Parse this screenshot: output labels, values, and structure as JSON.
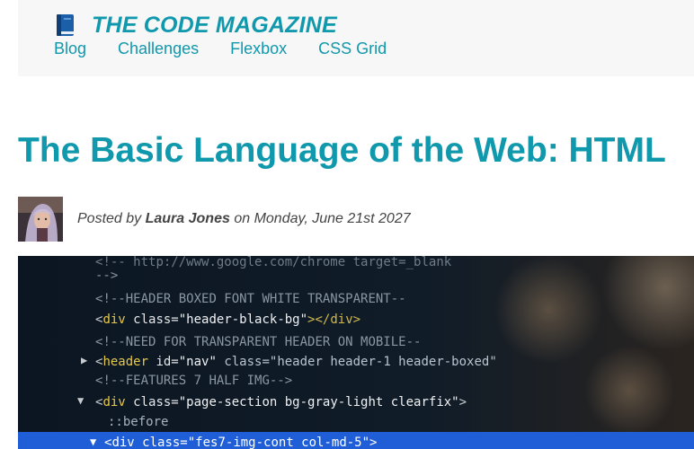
{
  "brand": {
    "title": "THE CODE MAGAZINE",
    "icon": "blue-book-icon",
    "color": "#1098ad"
  },
  "nav": {
    "items": [
      {
        "label": "Blog"
      },
      {
        "label": "Challenges"
      },
      {
        "label": "Flexbox"
      },
      {
        "label": "CSS Grid"
      }
    ]
  },
  "article": {
    "title": "The Basic Language of the Web: HTML",
    "byline": {
      "prefix": "Posted by",
      "author": "Laura Jones",
      "middle": "on",
      "date": "Monday, June 21st 2027"
    }
  },
  "hero": {
    "lines": [
      {
        "t1": "<",
        "t2": "!",
        "t3": "-- http://www.google.com/chrome",
        "t4": " target=_blank",
        "t5": ""
      },
      {
        "t1": "-->",
        "t2": "",
        "t3": "",
        "t4": "",
        "t5": ""
      },
      {
        "t1": "<",
        "t2": "!",
        "t3": "--HEADER BOXED FONT WHITE TRANSPARENT--",
        "t4": "",
        "t5": ""
      },
      {
        "t1": "<",
        "t2": "div",
        "t3": " class=",
        "t4": "\"header-black-bg\"",
        "t5": "></div>"
      },
      {
        "t1": "<",
        "t2": "!",
        "t3": "--NEED FOR TRANSPARENT HEADER ON MOBILE--",
        "t4": "",
        "t5": ""
      },
      {
        "t1": "<",
        "t2": "header",
        "t3": " id=",
        "t4": "\"nav\"",
        "t5": " class=\"header header-1 header-boxed\""
      },
      {
        "t1": "<",
        "t2": "!",
        "t3": "--FEATURES 7 HALF IMG-->",
        "t4": "",
        "t5": ""
      },
      {
        "t1": "<",
        "t2": "div",
        "t3": " class=",
        "t4": "\"page-section bg-gray-light clearfix\"",
        "t5": ">"
      },
      {
        "t1": "",
        "t2": "",
        "t3": "::before",
        "t4": "",
        "t5": ""
      },
      {
        "t1": "<",
        "t2": "div",
        "t3": " class=",
        "t4": "\"fes7-img-cont col-md-5\"",
        "t5": ">"
      }
    ]
  }
}
